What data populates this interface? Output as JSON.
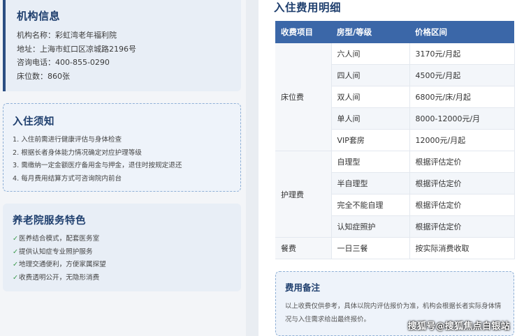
{
  "org": {
    "title": "机构信息",
    "name": "机构名称：彩虹湾老年福利院",
    "address": "地址：上海市虹口区凉城路2196号",
    "phone": "咨询电话：400-855-0290",
    "beds": "床位数：860张"
  },
  "notice": {
    "title": "入住须知",
    "items": [
      "1. 入住前需进行健康评估与身体检查",
      "2. 根据长者身体能力情况确定对应护理等级",
      "3. 需缴纳一定金额医疗备用金与押金，退住时按规定退还",
      "4. 每月费用结算方式可咨询院内前台"
    ]
  },
  "features": {
    "title": "养老院服务特色",
    "check": "✓",
    "items": [
      "医养结合模式，配套医务室",
      "提供认知症专业照护服务",
      "地理交通便利，方便家属探望",
      "收费透明公开，无隐形消费"
    ]
  },
  "fees": {
    "title": "入住费用明细",
    "headers": [
      "收费项目",
      "房型/等级",
      "价格区间"
    ],
    "groups": [
      {
        "category": "床位费",
        "rows": [
          {
            "sub": "六人间",
            "price": "3170元/月起"
          },
          {
            "sub": "四人间",
            "price": "4500元/月起"
          },
          {
            "sub": "双人间",
            "price": "6800元/床/月起"
          },
          {
            "sub": "单人间",
            "price": "8000-12000元/月"
          },
          {
            "sub": "VIP套房",
            "price": "12000元/月起"
          }
        ]
      },
      {
        "category": "护理费",
        "rows": [
          {
            "sub": "自理型",
            "price": "根据评估定价"
          },
          {
            "sub": "半自理型",
            "price": "根据评估定价"
          },
          {
            "sub": "完全不能自理",
            "price": "根据评估定价"
          },
          {
            "sub": "认知症照护",
            "price": "根据评估定价"
          }
        ]
      },
      {
        "category": "餐费",
        "rows": [
          {
            "sub": "一日三餐",
            "price": "按实际消费收取"
          }
        ]
      }
    ]
  },
  "note": {
    "title": "费用备注",
    "text": "以上收费仅供参考，具体以院内评估报价为准，机构会根据长者实际身体情况与入住需求给出最终报价。"
  },
  "watermark": "搜狐号@搜狐焦点白银站"
}
